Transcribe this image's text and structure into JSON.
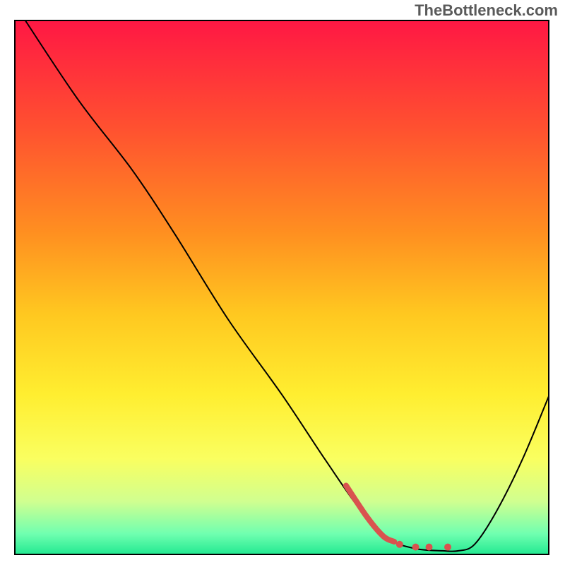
{
  "watermark": "TheBottleneck.com",
  "chart_data": {
    "type": "line",
    "title": "",
    "xlabel": "",
    "ylabel": "",
    "xlim": [
      0,
      100
    ],
    "ylim": [
      0,
      100
    ],
    "gradient_stops": [
      {
        "offset": 0,
        "color": "#ff1744"
      },
      {
        "offset": 20,
        "color": "#ff5030"
      },
      {
        "offset": 40,
        "color": "#ff9020"
      },
      {
        "offset": 55,
        "color": "#ffc820"
      },
      {
        "offset": 70,
        "color": "#ffee30"
      },
      {
        "offset": 82,
        "color": "#faff60"
      },
      {
        "offset": 90,
        "color": "#d0ff90"
      },
      {
        "offset": 96,
        "color": "#70ffb0"
      },
      {
        "offset": 100,
        "color": "#20e890"
      }
    ],
    "series": [
      {
        "name": "bottleneck-curve",
        "type": "line",
        "color": "#000000",
        "points": [
          {
            "x": 2,
            "y": 100
          },
          {
            "x": 12,
            "y": 85
          },
          {
            "x": 22,
            "y": 72
          },
          {
            "x": 30,
            "y": 60
          },
          {
            "x": 40,
            "y": 44
          },
          {
            "x": 50,
            "y": 30
          },
          {
            "x": 58,
            "y": 18
          },
          {
            "x": 65,
            "y": 8
          },
          {
            "x": 70,
            "y": 3
          },
          {
            "x": 75,
            "y": 1.2
          },
          {
            "x": 80,
            "y": 0.8
          },
          {
            "x": 83,
            "y": 0.8
          },
          {
            "x": 86,
            "y": 2
          },
          {
            "x": 90,
            "y": 8
          },
          {
            "x": 95,
            "y": 18
          },
          {
            "x": 100,
            "y": 30
          }
        ]
      },
      {
        "name": "highlight-segment",
        "type": "line",
        "color": "#d9534f",
        "stroke_width": 8,
        "points": [
          {
            "x": 62,
            "y": 13
          },
          {
            "x": 66,
            "y": 7
          },
          {
            "x": 69,
            "y": 3.5
          },
          {
            "x": 71,
            "y": 2.5
          }
        ]
      },
      {
        "name": "highlight-dots",
        "type": "scatter",
        "color": "#d9534f",
        "radius": 5,
        "points": [
          {
            "x": 72,
            "y": 2
          },
          {
            "x": 75,
            "y": 1.5
          },
          {
            "x": 77.5,
            "y": 1.5
          },
          {
            "x": 81,
            "y": 1.5
          }
        ]
      }
    ]
  }
}
